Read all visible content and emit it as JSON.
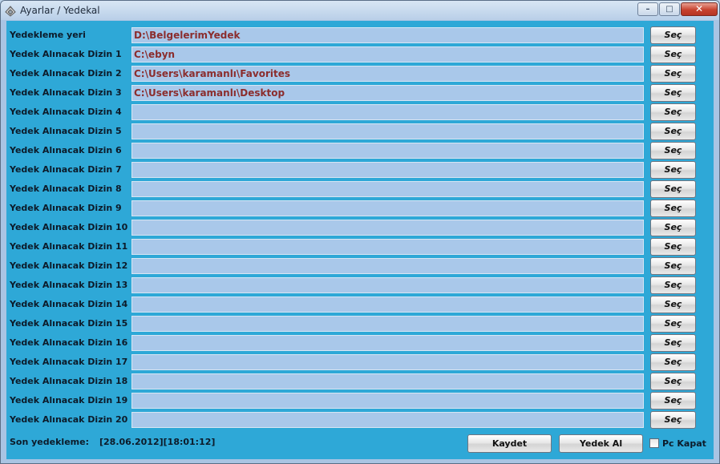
{
  "window": {
    "title": "Ayarlar / Yedekal",
    "minimize_label": "–",
    "maximize_label": "□",
    "close_label": "✕",
    "icon": "app-icon"
  },
  "rows": [
    {
      "label": "Yedekleme yeri",
      "value": "D:\\BelgelerimYedek",
      "button": "Seç"
    },
    {
      "label": "Yedek Alınacak Dizin 1",
      "value": "C:\\ebyn",
      "button": "Seç"
    },
    {
      "label": "Yedek Alınacak Dizin 2",
      "value": "C:\\Users\\karamanlı\\Favorites",
      "button": "Seç"
    },
    {
      "label": "Yedek Alınacak Dizin 3",
      "value": "C:\\Users\\karamanlı\\Desktop",
      "button": "Seç"
    },
    {
      "label": "Yedek Alınacak Dizin 4",
      "value": "",
      "button": "Seç"
    },
    {
      "label": "Yedek Alınacak Dizin 5",
      "value": "",
      "button": "Seç"
    },
    {
      "label": "Yedek Alınacak Dizin 6",
      "value": "",
      "button": "Seç"
    },
    {
      "label": "Yedek Alınacak Dizin 7",
      "value": "",
      "button": "Seç"
    },
    {
      "label": "Yedek Alınacak Dizin 8",
      "value": "",
      "button": "Seç"
    },
    {
      "label": "Yedek Alınacak Dizin 9",
      "value": "",
      "button": "Seç"
    },
    {
      "label": "Yedek Alınacak Dizin 10",
      "value": "",
      "button": "Seç"
    },
    {
      "label": "Yedek Alınacak Dizin 11",
      "value": "",
      "button": "Seç"
    },
    {
      "label": "Yedek Alınacak Dizin 12",
      "value": "",
      "button": "Seç"
    },
    {
      "label": "Yedek Alınacak Dizin 13",
      "value": "",
      "button": "Seç"
    },
    {
      "label": "Yedek Alınacak Dizin 14",
      "value": "",
      "button": "Seç"
    },
    {
      "label": "Yedek Alınacak Dizin 15",
      "value": "",
      "button": "Seç"
    },
    {
      "label": "Yedek Alınacak Dizin 16",
      "value": "",
      "button": "Seç"
    },
    {
      "label": "Yedek Alınacak Dizin 17",
      "value": "",
      "button": "Seç"
    },
    {
      "label": "Yedek Alınacak Dizin 18",
      "value": "",
      "button": "Seç"
    },
    {
      "label": "Yedek Alınacak Dizin 19",
      "value": "",
      "button": "Seç"
    },
    {
      "label": "Yedek Alınacak Dizin 20",
      "value": "",
      "button": "Seç"
    }
  ],
  "footer": {
    "last_backup_label": "Son yedekleme:",
    "last_backup_value": "[28.06.2012][18:01:12]",
    "save_button": "Kaydet",
    "backup_button": "Yedek Al",
    "shutdown_label": "Pc Kapat",
    "shutdown_checked": false
  },
  "colors": {
    "client_bg": "#2ea8d7",
    "field_bg": "#a9c8ea",
    "field_text": "#8b2d2d"
  }
}
